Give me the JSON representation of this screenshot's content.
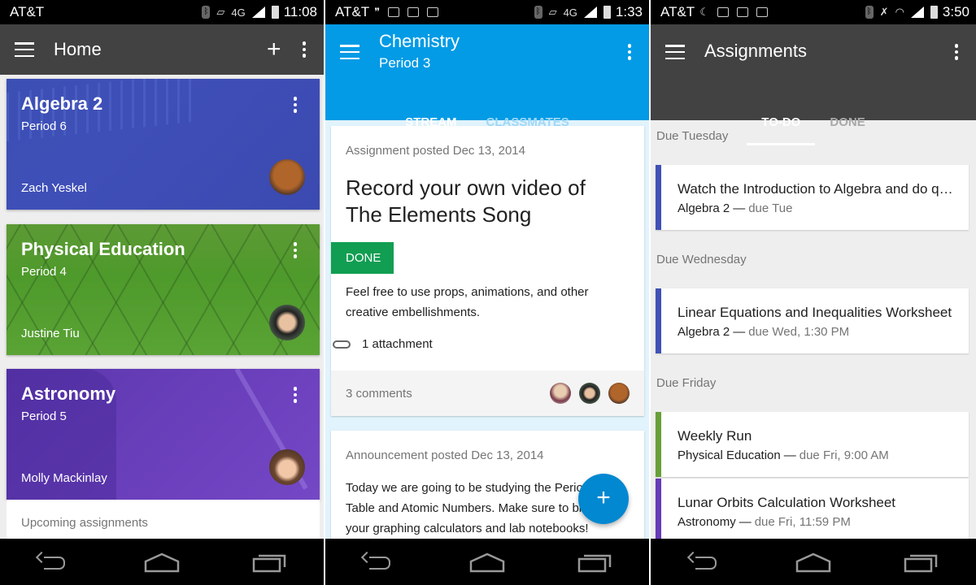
{
  "colors": {
    "algebra": "#3f51b5",
    "pe": "#689f38",
    "astronomy": "#673ab7",
    "chemistry_bar": "#039be5",
    "done_green": "#119e52",
    "fab_blue": "#0288d1"
  },
  "screens": [
    {
      "status": {
        "carrier": "AT&T",
        "time": "11:08",
        "network": "4G"
      },
      "appbar": {
        "title": "Home",
        "menu_icon": "hamburger-icon",
        "add_icon": "plus-icon",
        "more_icon": "more-vert-icon"
      },
      "courses": [
        {
          "title": "Algebra 2",
          "period": "Period 6",
          "teacher": "Zach Yeskel"
        },
        {
          "title": "Physical Education",
          "period": "Period 4",
          "teacher": "Justine Tiu"
        },
        {
          "title": "Astronomy",
          "period": "Period 5",
          "teacher": "Molly Mackinlay"
        }
      ],
      "upcoming_label": "Upcoming assignments"
    },
    {
      "status": {
        "carrier": "AT&T",
        "time": "1:33",
        "network": "4G"
      },
      "appbar": {
        "title": "Chemistry",
        "subtitle": "Period 3"
      },
      "tabs": [
        {
          "label": "STREAM",
          "active": true
        },
        {
          "label": "CLASSMATES",
          "active": false
        }
      ],
      "posts": [
        {
          "meta": "Assignment posted Dec 13, 2014",
          "title": "Record your own video of The Elements Song",
          "status": "DONE",
          "description": "Feel free to use props, animations, and other creative embellishments.",
          "attachments": "1 attachment",
          "comments": "3 comments"
        },
        {
          "meta": "Announcement posted Dec 13, 2014",
          "description": "Today we are going to be studying the Periodic Table and Atomic Numbers. Make sure to bring your graphing calculators and lab notebooks!"
        }
      ],
      "fab_label": "+"
    },
    {
      "status": {
        "carrier": "AT&T",
        "time": "3:50"
      },
      "appbar": {
        "title": "Assignments"
      },
      "tabs": [
        {
          "label": "TO-DO",
          "active": true
        },
        {
          "label": "DONE",
          "active": false
        }
      ],
      "groups": [
        {
          "label": "Due Tuesday",
          "items": [
            {
              "title": "Watch the Introduction to Algebra and do q…",
              "course": "Algebra 2",
              "due": "due Tue",
              "color": "#3f51b5"
            }
          ]
        },
        {
          "label": "Due Wednesday",
          "items": [
            {
              "title": "Linear Equations and Inequalities Worksheet",
              "course": "Algebra 2",
              "due": "due Wed, 1:30 PM",
              "color": "#3f51b5"
            }
          ]
        },
        {
          "label": "Due Friday",
          "items": [
            {
              "title": "Weekly Run",
              "course": "Physical Education",
              "due": "due Fri, 9:00 AM",
              "color": "#689f38"
            },
            {
              "title": "Lunar Orbits Calculation Worksheet",
              "course": "Astronomy",
              "due": "due Fri, 11:59 PM",
              "color": "#673ab7"
            }
          ]
        }
      ],
      "dash": "—"
    }
  ]
}
